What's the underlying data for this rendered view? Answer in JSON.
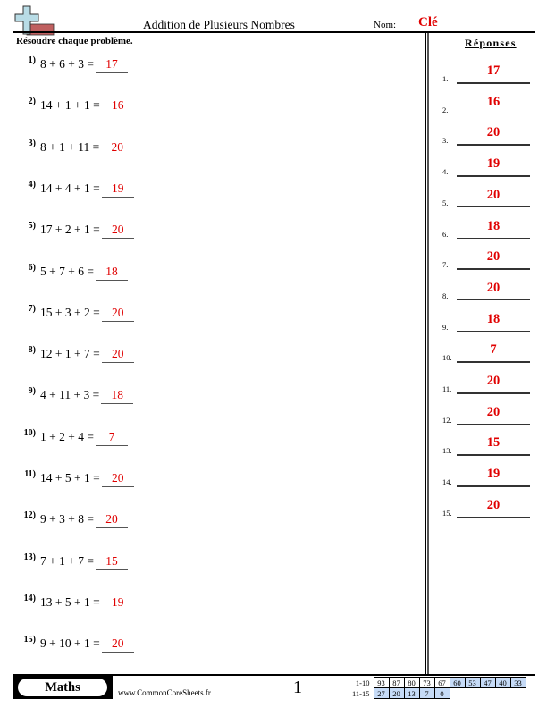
{
  "header": {
    "title": "Addition de Plusieurs Nombres",
    "name_label": "Nom:",
    "name_value": "Clé",
    "logo_icon": "plus-sign-logo-icon"
  },
  "instructions": "Résoudre chaque problème.",
  "problems": [
    {
      "num": "1)",
      "expr": "8 + 6 + 3 =",
      "answer": "17"
    },
    {
      "num": "2)",
      "expr": "14 + 1 + 1 =",
      "answer": "16"
    },
    {
      "num": "3)",
      "expr": "8 + 1 + 11 =",
      "answer": "20"
    },
    {
      "num": "4)",
      "expr": "14 + 4 + 1 =",
      "answer": "19"
    },
    {
      "num": "5)",
      "expr": "17 + 2 + 1 =",
      "answer": "20"
    },
    {
      "num": "6)",
      "expr": "5 + 7 + 6 =",
      "answer": "18"
    },
    {
      "num": "7)",
      "expr": "15 + 3 + 2 =",
      "answer": "20"
    },
    {
      "num": "8)",
      "expr": "12 + 1 + 7 =",
      "answer": "20"
    },
    {
      "num": "9)",
      "expr": "4 + 11 + 3 =",
      "answer": "18"
    },
    {
      "num": "10)",
      "expr": "1 + 2 + 4 =",
      "answer": "7"
    },
    {
      "num": "11)",
      "expr": "14 + 5 + 1 =",
      "answer": "20"
    },
    {
      "num": "12)",
      "expr": "9 + 3 + 8 =",
      "answer": "20"
    },
    {
      "num": "13)",
      "expr": "7 + 1 + 7 =",
      "answer": "15"
    },
    {
      "num": "14)",
      "expr": "13 + 5 + 1 =",
      "answer": "19"
    },
    {
      "num": "15)",
      "expr": "9 + 10 + 1 =",
      "answer": "20"
    }
  ],
  "answers_key": {
    "header": "Réponses",
    "items": [
      {
        "num": "1.",
        "value": "17"
      },
      {
        "num": "2.",
        "value": "16"
      },
      {
        "num": "3.",
        "value": "20"
      },
      {
        "num": "4.",
        "value": "19"
      },
      {
        "num": "5.",
        "value": "20"
      },
      {
        "num": "6.",
        "value": "18"
      },
      {
        "num": "7.",
        "value": "20"
      },
      {
        "num": "8.",
        "value": "20"
      },
      {
        "num": "9.",
        "value": "18"
      },
      {
        "num": "10.",
        "value": "7"
      },
      {
        "num": "11.",
        "value": "20"
      },
      {
        "num": "12.",
        "value": "20"
      },
      {
        "num": "13.",
        "value": "15"
      },
      {
        "num": "14.",
        "value": "19"
      },
      {
        "num": "15.",
        "value": "20"
      }
    ]
  },
  "footer": {
    "badge": "Maths",
    "url": "www.CommonCoreSheets.fr",
    "page": "1",
    "score_table": {
      "rows": [
        {
          "label": "1-10",
          "values": [
            "93",
            "87",
            "80",
            "73",
            "67",
            "60",
            "53",
            "47",
            "40",
            "33"
          ]
        },
        {
          "label": "11-15",
          "values": [
            "27",
            "20",
            "13",
            "7",
            "0"
          ]
        }
      ]
    }
  },
  "colors": {
    "answer_red": "#e00000",
    "score_blue": "#c6dbf7",
    "logo_plus": "#b8dce6",
    "logo_bar": "#c06060"
  }
}
